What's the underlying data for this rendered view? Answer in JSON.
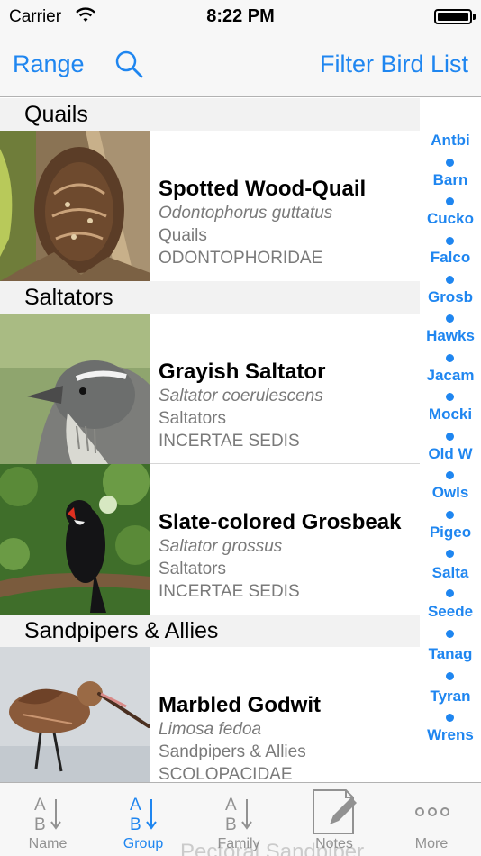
{
  "status_bar": {
    "carrier": "Carrier",
    "time": "8:22 PM"
  },
  "navbar": {
    "range_label": "Range",
    "filter_label": "Filter Bird List",
    "search_icon": "search-icon"
  },
  "sections": [
    {
      "title": "Quails",
      "birds": [
        {
          "name": "Spotted Wood-Quail",
          "latin": "Odontophorus guttatus",
          "group": "Quails",
          "family": "ODONTOPHORIDAE"
        }
      ]
    },
    {
      "title": "Saltators",
      "birds": [
        {
          "name": "Grayish Saltator",
          "latin": "Saltator coerulescens",
          "group": "Saltators",
          "family": "INCERTAE SEDIS"
        },
        {
          "name": "Slate-colored Grosbeak",
          "latin": "Saltator grossus",
          "group": "Saltators",
          "family": "INCERTAE SEDIS"
        }
      ]
    },
    {
      "title": "Sandpipers & Allies",
      "birds": [
        {
          "name": "Marbled Godwit",
          "latin": "Limosa fedoa",
          "group": "Sandpipers & Allies",
          "family": "SCOLOPACIDAE"
        }
      ]
    }
  ],
  "section_index": [
    "Antbi",
    "Barn",
    "Cucko",
    "Falco",
    "Grosb",
    "Hawks",
    "Jacam",
    "Mocki",
    "Old W",
    "Owls",
    "Pigeo",
    "Salta",
    "Seede",
    "Tanag",
    "Tyran",
    "Wrens"
  ],
  "tabbar": {
    "tabs": [
      {
        "label": "Name",
        "icon": "sort-ab-icon",
        "active": false
      },
      {
        "label": "Group",
        "icon": "sort-ab-icon",
        "active": true
      },
      {
        "label": "Family",
        "icon": "sort-ab-icon",
        "active": false
      },
      {
        "label": "Notes",
        "icon": "notes-edit-icon",
        "active": false
      },
      {
        "label": "More",
        "icon": "more-dots-icon",
        "active": false
      }
    ],
    "ghost_text": "Pectoral Sandpiper"
  },
  "colors": {
    "accent": "#1f86f0",
    "section_header_bg": "#f2f2f2",
    "secondary_text": "#7a7a7a"
  }
}
